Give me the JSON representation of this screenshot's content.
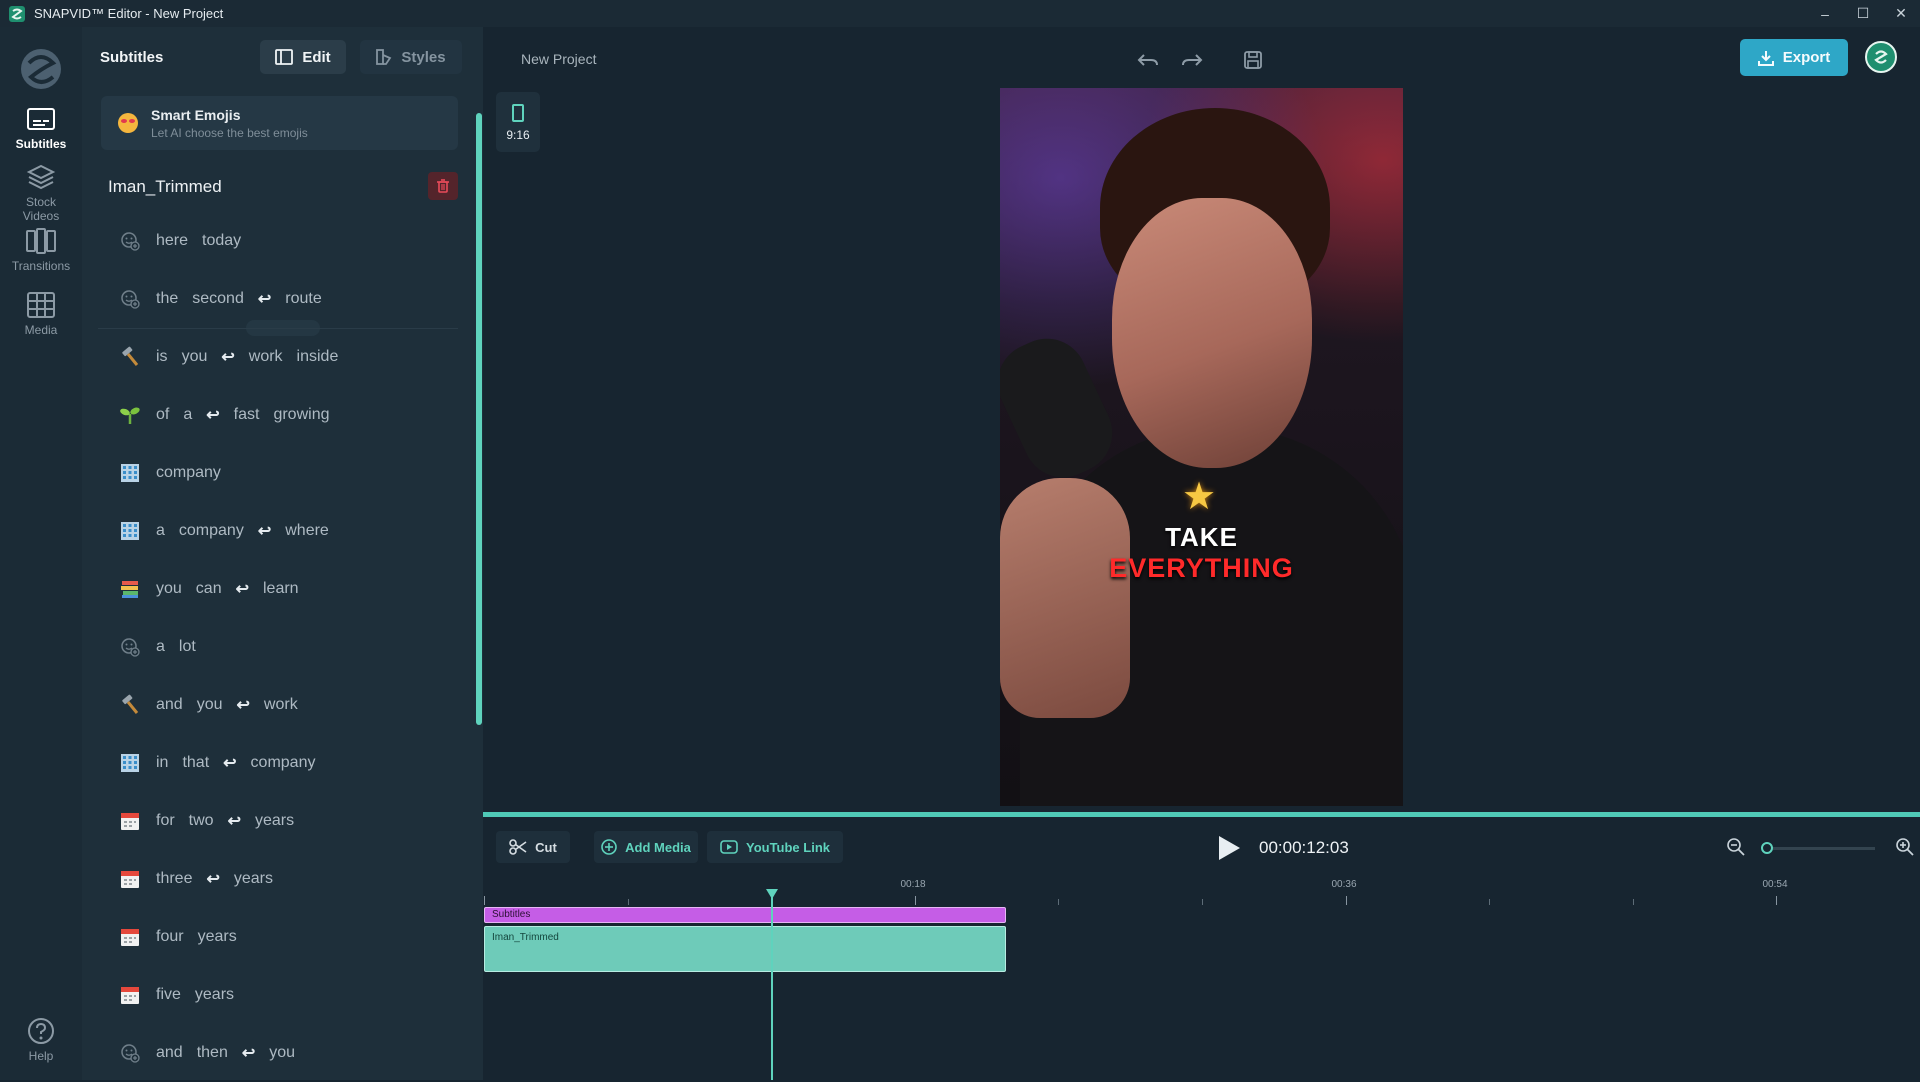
{
  "window": {
    "title": "SNAPVID™ Editor - New Project"
  },
  "nav": [
    {
      "id": "subtitles",
      "label": "Subtitles",
      "icon": "subtitles-icon",
      "active": true
    },
    {
      "id": "stock-videos",
      "label": "Stock\nVideos",
      "icon": "layers-icon",
      "active": false
    },
    {
      "id": "transitions",
      "label": "Transitions",
      "icon": "transitions-icon",
      "active": false
    },
    {
      "id": "media",
      "label": "Media",
      "icon": "media-grid-icon",
      "active": false
    },
    {
      "id": "help",
      "label": "Help",
      "icon": "help-icon",
      "active": false
    }
  ],
  "panel": {
    "title": "Subtitles",
    "edit_label": "Edit",
    "styles_label": "Styles",
    "smart_emojis": {
      "title": "Smart Emojis",
      "subtitle": "Let AI choose the best emojis"
    },
    "clip_name": "Iman_Trimmed",
    "rows": [
      {
        "icon": "add-emoji-icon",
        "segments": [
          "here",
          "today"
        ]
      },
      {
        "icon": "add-emoji-icon",
        "segments": [
          "the",
          "second",
          "↩",
          "route"
        ]
      },
      {
        "icon": "hammer-emoji-icon",
        "segments": [
          "is",
          "you",
          "↩",
          "work",
          "inside"
        ]
      },
      {
        "icon": "seedling-emoji-icon",
        "segments": [
          "of",
          "a",
          "↩",
          "fast",
          "growing"
        ]
      },
      {
        "icon": "office-building-emoji-icon",
        "segments": [
          "company"
        ]
      },
      {
        "icon": "office-building-emoji-icon",
        "segments": [
          "a",
          "company",
          "↩",
          "where"
        ]
      },
      {
        "icon": "books-emoji-icon",
        "segments": [
          "you",
          "can",
          "↩",
          "learn"
        ]
      },
      {
        "icon": "add-emoji-icon",
        "segments": [
          "a",
          "lot"
        ]
      },
      {
        "icon": "hammer-emoji-icon",
        "segments": [
          "and",
          "you",
          "↩",
          "work"
        ]
      },
      {
        "icon": "office-building-emoji-icon",
        "segments": [
          "in",
          "that",
          "↩",
          "company"
        ]
      },
      {
        "icon": "calendar-emoji-icon",
        "segments": [
          "for",
          "two",
          "↩",
          "years"
        ]
      },
      {
        "icon": "calendar-emoji-icon",
        "segments": [
          "three",
          "↩",
          "years"
        ]
      },
      {
        "icon": "calendar-emoji-icon",
        "segments": [
          "four",
          "years"
        ]
      },
      {
        "icon": "calendar-emoji-icon",
        "segments": [
          "five",
          "years"
        ]
      },
      {
        "icon": "add-emoji-icon",
        "segments": [
          "and",
          "then",
          "↩",
          "you"
        ]
      }
    ]
  },
  "main": {
    "project_name": "New Project",
    "export_label": "Export",
    "aspect_ratio": "9:16",
    "caption": {
      "emoji": "★",
      "line1": "TAKE",
      "line2": "EVERYTHING"
    },
    "tools": {
      "cut": "Cut",
      "add_media": "Add Media",
      "youtube_link": "YouTube Link"
    },
    "timecode": "00:00:12:03",
    "ruler_labels": [
      "00:18",
      "00:36",
      "00:54"
    ],
    "tracks": {
      "subtitles": "Subtitles",
      "video": "Iman_Trimmed"
    }
  },
  "colors": {
    "accent": "#5fd3bd",
    "export_button": "#2ea7c7",
    "subtitle_track": "#c55de6",
    "video_track": "#6ecbb9",
    "caption_red": "#ff2a2a"
  }
}
